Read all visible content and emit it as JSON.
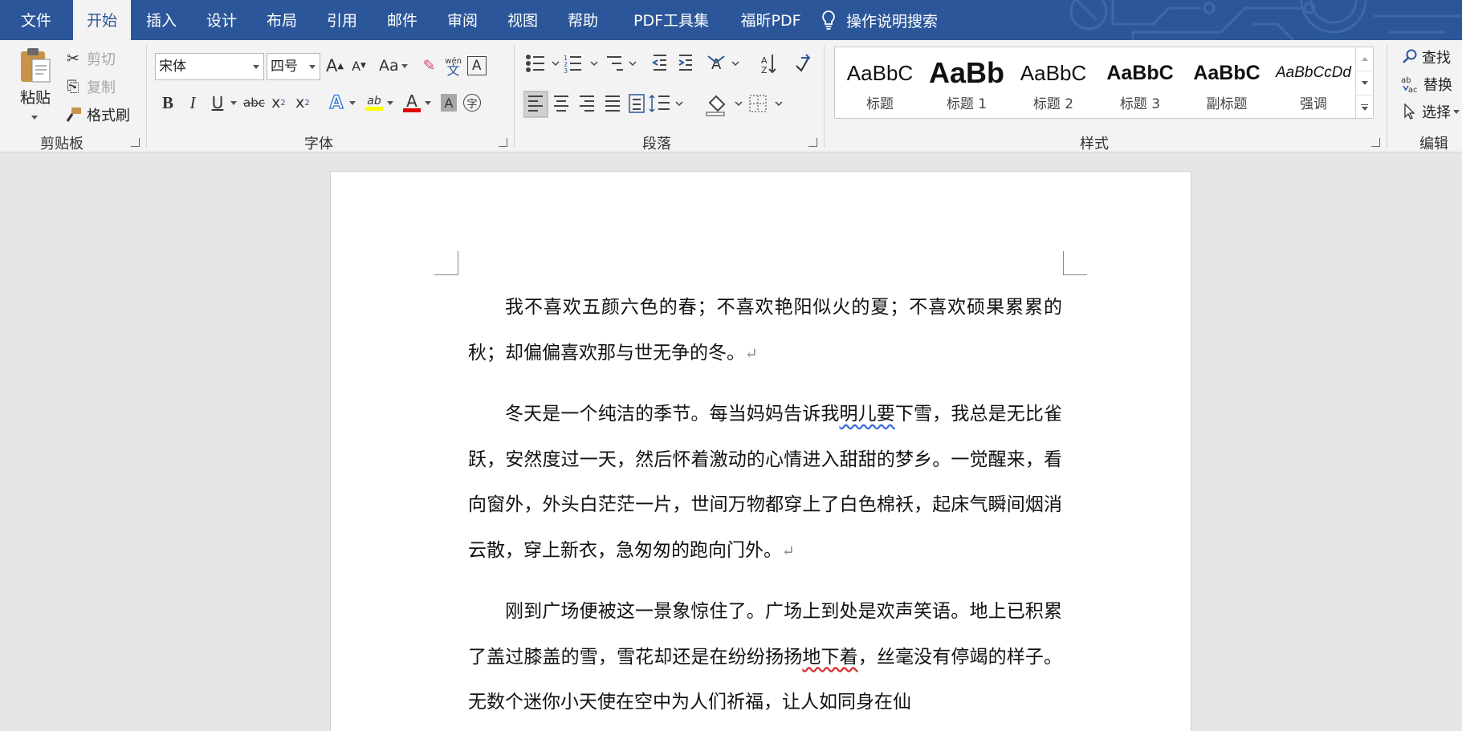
{
  "tabs": [
    {
      "label": "文件",
      "active": false
    },
    {
      "label": "开始",
      "active": true
    },
    {
      "label": "插入",
      "active": false
    },
    {
      "label": "设计",
      "active": false
    },
    {
      "label": "布局",
      "active": false
    },
    {
      "label": "引用",
      "active": false
    },
    {
      "label": "邮件",
      "active": false
    },
    {
      "label": "审阅",
      "active": false
    },
    {
      "label": "视图",
      "active": false
    },
    {
      "label": "帮助",
      "active": false
    },
    {
      "label": "PDF工具集",
      "active": false
    },
    {
      "label": "福昕PDF",
      "active": false
    }
  ],
  "tell_me": {
    "label": "操作说明搜索"
  },
  "clipboard": {
    "paste": "粘贴",
    "cut": "剪切",
    "copy": "复制",
    "format_painter": "格式刷",
    "group_label": "剪贴板"
  },
  "font": {
    "name": "宋体",
    "size": "四号",
    "grow": "A",
    "shrink": "A",
    "change_case": "Aa",
    "phonetic_top": "wén",
    "phonetic_char": "文",
    "border_char": "A",
    "bold": "B",
    "italic": "I",
    "underline": "U",
    "strike": "abc",
    "sub": "x",
    "sub_suffix": "2",
    "sup": "x",
    "sup_suffix": "2",
    "text_effects": "A",
    "highlight": "ab",
    "font_color": "A",
    "char_shading": "A",
    "enclose": "字",
    "highlight_color": "#ffff00",
    "font_color_value": "#e00000",
    "group_label": "字体"
  },
  "paragraph": {
    "group_label": "段落"
  },
  "styles": {
    "items": [
      {
        "preview": "AaBbC",
        "name": "标题"
      },
      {
        "preview": "AaBb",
        "name": "标题 1"
      },
      {
        "preview": "AaBbC",
        "name": "标题 2"
      },
      {
        "preview": "AaBbC",
        "name": "标题 3"
      },
      {
        "preview": "AaBbC",
        "name": "副标题"
      },
      {
        "preview": "AaBbCcDd",
        "name": "强调"
      }
    ],
    "group_label": "样式"
  },
  "editing": {
    "find": "查找",
    "replace": "替换",
    "select": "选择",
    "group_label": "编辑"
  },
  "document": {
    "p1": {
      "text": "我不喜欢五颜六色的春；不喜欢艳阳似火的夏；不喜欢硕果累累的秋；却偏偏喜欢那与世无争的冬。"
    },
    "p2": {
      "pre": "冬天是一个纯洁的季节。每当妈妈告诉我",
      "sq": "明儿要",
      "post": "下雪，我总是无比雀跃，安然度过一天，然后怀着激动的心情进入甜甜的梦乡。一觉醒来，看向窗外，外头白茫茫一片，世间万物都穿上了白色棉袄，起床气瞬间烟消云散，穿上新衣，急匆匆的跑向门外。"
    },
    "p3": {
      "pre": "刚到广场便被这一景象惊住了。广场上到处是欢声笑语。地上已积累了盖过膝盖的雪，雪花却还是在纷纷扬扬",
      "sq": "地下着",
      "post": "，丝毫没有停竭的样子。无数个迷你小天使在空中为人们祈福，让人如同身在仙"
    },
    "para_mark": "↵"
  },
  "colors": {
    "ribbon_blue": "#2b579a",
    "ribbon_bg": "#f3f3f3",
    "canvas": "#e6e6e6"
  }
}
